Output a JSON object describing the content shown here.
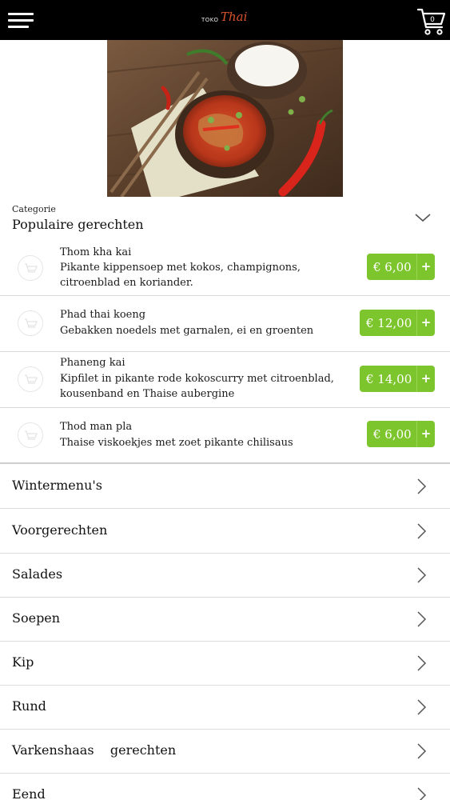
{
  "header": {
    "logo_small": "TOKO",
    "logo_main": "Thai",
    "menu_icon": "hamburger-menu-icon",
    "cart_icon": "shopping-cart-icon"
  },
  "hero": {
    "image": "red-curry-with-rice-photo"
  },
  "category": {
    "caption": "Categorie",
    "title": "Populaire gerechten"
  },
  "dishes": [
    {
      "name": "Thom kha kai",
      "desc": "Pikante kippensoep  met kokos, champignons,\ncitroenblad  en koriander.",
      "price": "€ 6,00"
    },
    {
      "name": "Phad  thai koeng",
      "desc": "Gebakken  noedels  met garnalen,  ei en groenten",
      "price": "€ 12,00"
    },
    {
      "name": "Phaneng  kai",
      "desc": "Kipfilet in pikante  rode  kokoscurry  met citroenblad,\nkousenband   en Thaise  aubergine",
      "price": "€ 14,00"
    },
    {
      "name": "Thod man  pla",
      "desc": "Thaise  viskoekjes  met zoet pikante  chilisaus",
      "price": "€ 6,00"
    }
  ],
  "add_symbol": "+",
  "categories": [
    {
      "label": "Wintermenu's"
    },
    {
      "label": "Voorgerechten"
    },
    {
      "label": "Salades"
    },
    {
      "label": "Soepen"
    },
    {
      "label": "Kip"
    },
    {
      "label": "Rund"
    },
    {
      "label": "Varkenshaas    gerechten"
    },
    {
      "label": "Eend"
    }
  ],
  "colors": {
    "accent": "#7dc52c",
    "topbar": "#000000"
  }
}
